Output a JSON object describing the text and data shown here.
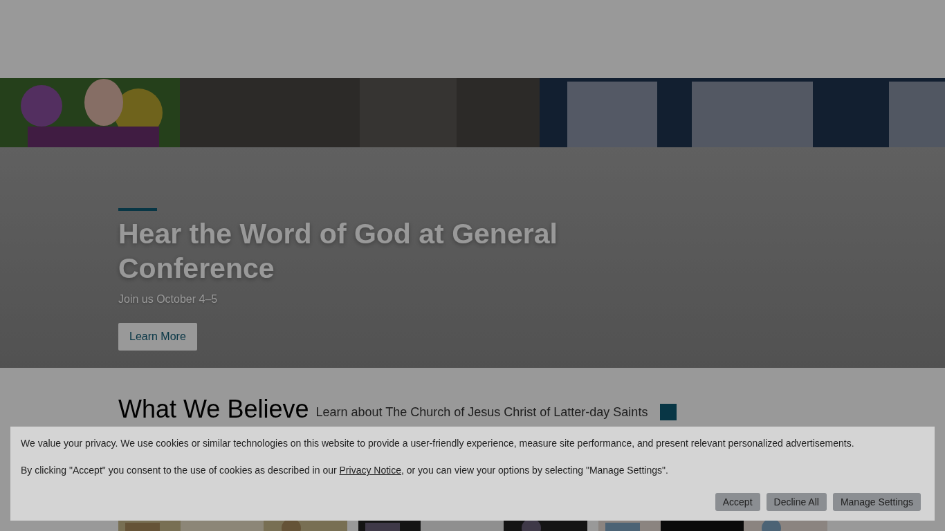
{
  "hero": {
    "title": "Hear the Word of God at General Conference",
    "subtitle": "Join us October 4–5",
    "button": "Learn More"
  },
  "section": {
    "title": "What We Believe",
    "subtitle": "Learn about The Church of Jesus Christ of Latter-day Saints"
  },
  "cookie_banner": {
    "message": "We value your privacy. We use cookies or similar technologies on this website to provide a user-friendly experience, measure site performance, and present relevant personalized advertisements.",
    "consent": "By clicking \"Accept\" you consent to the use of cookies as described in our ",
    "link": "Privacy Notice",
    "consent_end": ", or you can view your options by selecting \"Manage Settings\".",
    "buttons": [
      "Accept",
      "Decline All",
      "Manage Settings"
    ]
  }
}
